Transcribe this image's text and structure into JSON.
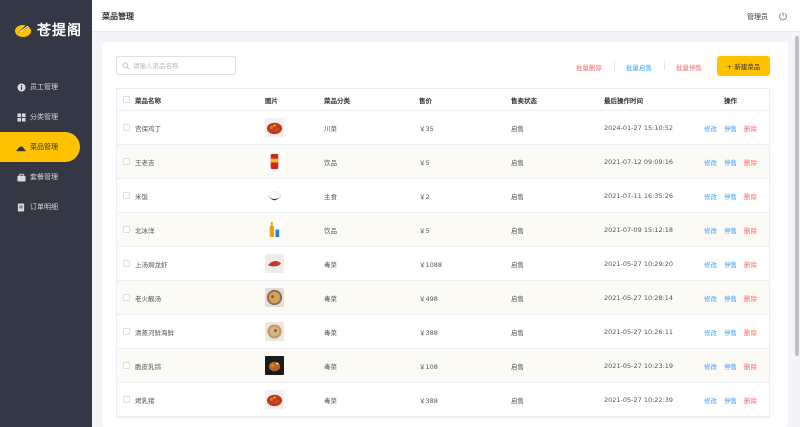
{
  "app": {
    "logo_text": "苍提阁"
  },
  "sidebar": {
    "items": [
      {
        "label": "员工管理",
        "icon": "info-icon"
      },
      {
        "label": "分类管理",
        "icon": "grid-icon"
      },
      {
        "label": "菜品管理",
        "icon": "dish-icon",
        "active": true
      },
      {
        "label": "套餐管理",
        "icon": "combo-icon"
      },
      {
        "label": "订单明细",
        "icon": "order-icon"
      }
    ]
  },
  "header": {
    "title": "菜品管理",
    "user": "管理员",
    "logout_icon": "power-icon"
  },
  "toolbar": {
    "search_placeholder": "请输入菜品名称",
    "batch_delete": "批量删除",
    "batch_enable": "批量启售",
    "batch_disable": "批量停售",
    "add_label": "+ 新建菜品"
  },
  "table": {
    "columns": [
      "菜品名称",
      "图片",
      "菜品分类",
      "售价",
      "售卖状态",
      "最后操作时间",
      "操作"
    ],
    "ops": {
      "edit": "修改",
      "toggle": "停售",
      "remove": "删除"
    },
    "rows": [
      {
        "name": "宫保鸡丁",
        "category": "川菜",
        "price": "￥35",
        "status": "启售",
        "time": "2024-01-27 15:10:52",
        "img": "dish-red"
      },
      {
        "name": "王老吉",
        "category": "饮品",
        "price": "￥5",
        "status": "启售",
        "time": "2021-07-12 09:09:16",
        "img": "can"
      },
      {
        "name": "米饭",
        "category": "主食",
        "price": "￥2",
        "status": "启售",
        "time": "2021-07-11 16:35:26",
        "img": "rice"
      },
      {
        "name": "北冰洋",
        "category": "饮品",
        "price": "￥5",
        "status": "启售",
        "time": "2021-07-09 15:12:18",
        "img": "bottle"
      },
      {
        "name": "上汤焗龙虾",
        "category": "毒菜",
        "price": "￥1088",
        "status": "启售",
        "time": "2021-05-27 10:29:20",
        "img": "lobster"
      },
      {
        "name": "老火靓汤",
        "category": "毒菜",
        "price": "￥498",
        "status": "启售",
        "time": "2021-05-27 10:28:14",
        "img": "soup"
      },
      {
        "name": "清蒸河鲜海鲜",
        "category": "毒菜",
        "price": "￥388",
        "status": "启售",
        "time": "2021-05-27 10:26:11",
        "img": "bowl"
      },
      {
        "name": "脆皮乳鸽",
        "category": "毒菜",
        "price": "￥108",
        "status": "启售",
        "time": "2021-05-27 10:23:19",
        "img": "pigeon"
      },
      {
        "name": "烤乳猪",
        "category": "毒菜",
        "price": "￥388",
        "status": "启售",
        "time": "2021-05-27 10:22:39",
        "img": "dish-red"
      }
    ]
  },
  "colors": {
    "sidebar": "#343744",
    "accent": "#ffc200",
    "link": "#409eff",
    "danger": "#f56c6c"
  }
}
